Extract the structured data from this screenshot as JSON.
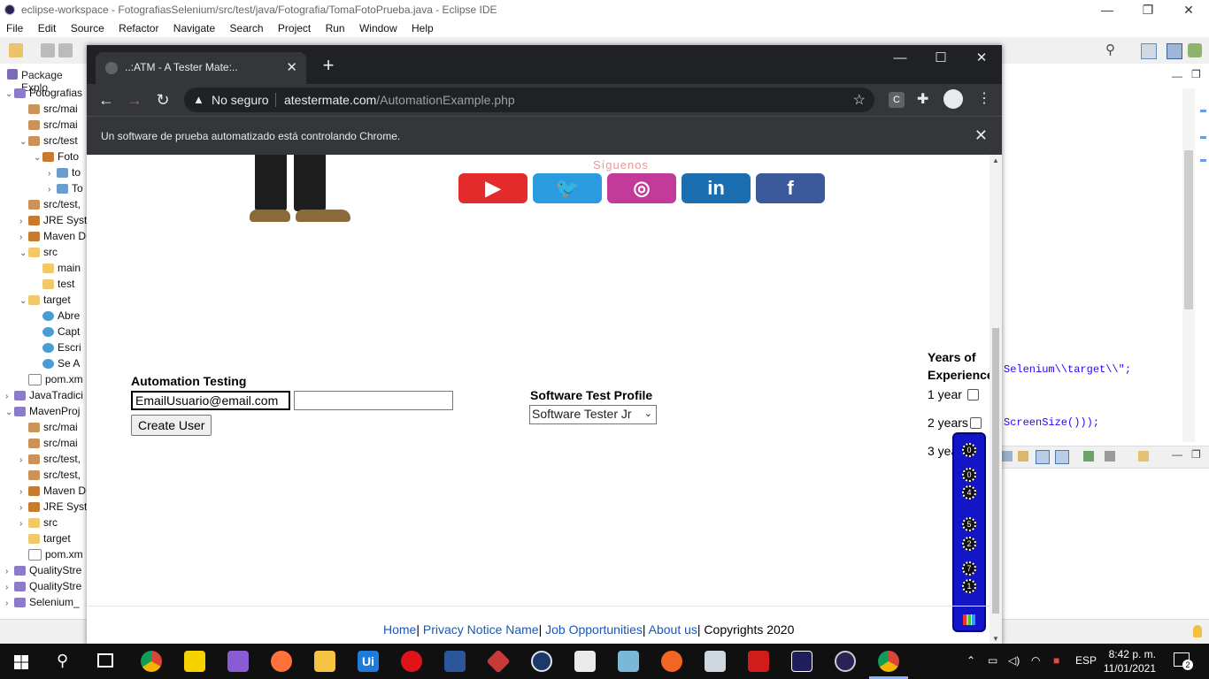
{
  "eclipse": {
    "title": "eclipse-workspace - FotografiasSelenium/src/test/java/Fotografia/TomaFotoPrueba.java - Eclipse IDE",
    "menu": [
      "File",
      "Edit",
      "Source",
      "Refactor",
      "Navigate",
      "Search",
      "Project",
      "Run",
      "Window",
      "Help"
    ],
    "package_explorer_tab": "Package Explo",
    "tree": [
      {
        "label": "Fotografias",
        "icon": "project-icon",
        "level": 0,
        "arrow": "v"
      },
      {
        "label": "src/mai",
        "icon": "package-folder-icon",
        "level": 1,
        "arrow": ""
      },
      {
        "label": "src/mai",
        "icon": "package-folder-icon",
        "level": 1,
        "arrow": ""
      },
      {
        "label": "src/test",
        "icon": "package-folder-icon",
        "level": 1,
        "arrow": "v"
      },
      {
        "label": "Foto",
        "icon": "package-icon",
        "level": 2,
        "arrow": "v"
      },
      {
        "label": "to",
        "icon": "java-file-icon",
        "level": 3,
        "arrow": ">"
      },
      {
        "label": "To",
        "icon": "java-file-icon",
        "level": 3,
        "arrow": ">"
      },
      {
        "label": "src/test,",
        "icon": "package-folder-icon",
        "level": 1,
        "arrow": ""
      },
      {
        "label": "JRE Syst",
        "icon": "library-icon",
        "level": 1,
        "arrow": ">"
      },
      {
        "label": "Maven D",
        "icon": "library-icon",
        "level": 1,
        "arrow": ">"
      },
      {
        "label": "src",
        "icon": "folder-icon",
        "level": 1,
        "arrow": "v"
      },
      {
        "label": "main",
        "icon": "folder-icon",
        "level": 2,
        "arrow": ""
      },
      {
        "label": "test",
        "icon": "folder-icon",
        "level": 2,
        "arrow": ""
      },
      {
        "label": "target",
        "icon": "folder-icon",
        "level": 1,
        "arrow": "v"
      },
      {
        "label": "Abre",
        "icon": "globe-icon",
        "level": 2,
        "arrow": ""
      },
      {
        "label": "Capt",
        "icon": "globe-icon",
        "level": 2,
        "arrow": ""
      },
      {
        "label": "Escri",
        "icon": "globe-icon",
        "level": 2,
        "arrow": ""
      },
      {
        "label": "Se A",
        "icon": "globe-icon",
        "level": 2,
        "arrow": ""
      },
      {
        "label": "pom.xm",
        "icon": "xml-file-icon",
        "level": 1,
        "arrow": ""
      },
      {
        "label": "JavaTradici",
        "icon": "project-icon",
        "level": 0,
        "arrow": ">"
      },
      {
        "label": "MavenProj",
        "icon": "project-icon",
        "level": 0,
        "arrow": "v"
      },
      {
        "label": "src/mai",
        "icon": "package-folder-icon",
        "level": 1,
        "arrow": ""
      },
      {
        "label": "src/mai",
        "icon": "package-folder-icon",
        "level": 1,
        "arrow": ""
      },
      {
        "label": "src/test,",
        "icon": "package-folder-icon",
        "level": 1,
        "arrow": ">"
      },
      {
        "label": "src/test,",
        "icon": "package-folder-icon",
        "level": 1,
        "arrow": ""
      },
      {
        "label": "Maven D",
        "icon": "library-icon",
        "level": 1,
        "arrow": ">"
      },
      {
        "label": "JRE Syst",
        "icon": "library-icon",
        "level": 1,
        "arrow": ">"
      },
      {
        "label": "src",
        "icon": "folder-icon",
        "level": 1,
        "arrow": ">"
      },
      {
        "label": "target",
        "icon": "folder-icon",
        "level": 1,
        "arrow": ""
      },
      {
        "label": "pom.xm",
        "icon": "xml-file-icon",
        "level": 1,
        "arrow": ""
      },
      {
        "label": "QualityStre",
        "icon": "project-icon",
        "level": 0,
        "arrow": ">"
      },
      {
        "label": "QualityStre",
        "icon": "project-icon",
        "level": 0,
        "arrow": ">"
      },
      {
        "label": "Selenium_",
        "icon": "project-icon",
        "level": 0,
        "arrow": ">"
      }
    ],
    "code_lines": [
      "Selenium\\\\target\\\\\";",
      "ScreenSize()));"
    ]
  },
  "chrome": {
    "tab_title": "..:ATM - A Tester Mate:..",
    "security": "No seguro",
    "url_host": "atestermate.com",
    "url_path": "/AutomationExample.php",
    "infobar": "Un software de prueba automatizado está controlando Chrome."
  },
  "page": {
    "siguenos": "Síguenos",
    "socials": [
      {
        "name": "youtube",
        "glyph": "▶",
        "color": "#e32b2b"
      },
      {
        "name": "twitter",
        "glyph": "🐦",
        "color": "#2b9be0"
      },
      {
        "name": "instagram",
        "glyph": "◎",
        "color": "#c23a9a"
      },
      {
        "name": "linkedin",
        "glyph": "in",
        "color": "#1b6fb0"
      },
      {
        "name": "facebook",
        "glyph": "f",
        "color": "#3a5a9c"
      }
    ],
    "automation_title": "Automation Testing",
    "email_value": "EmailUsuario@email.com",
    "second_input_value": "",
    "create_button": "Create User",
    "profile_title": "Software Test Profile",
    "profile_selected": "Software Tester Jr",
    "years_title_1": "Years of",
    "years_title_2": "Experience",
    "years_options": [
      "1 year",
      "2 years",
      "3 years"
    ],
    "counter_digits": [
      "0",
      "0",
      "4",
      "5",
      "2",
      "7",
      "1"
    ],
    "footer": {
      "home": "Home",
      "privacy": "Privacy Notice Name",
      "jobs": "Job Opportunities",
      "about": "About us",
      "copyright": "Copyrights 2020"
    }
  },
  "taskbar": {
    "lang": "ESP",
    "time": "8:42 p. m.",
    "date": "11/01/2021",
    "notifications": "2"
  }
}
